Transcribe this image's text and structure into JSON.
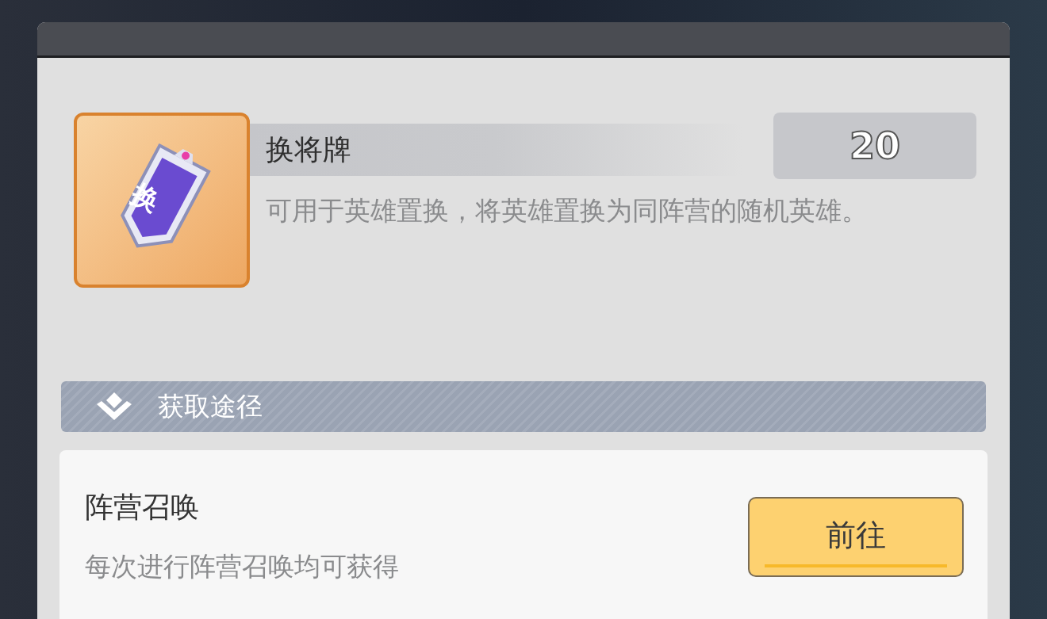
{
  "item": {
    "icon_glyph": "换",
    "name": "换将牌",
    "count": "20",
    "description": "可用于英雄置换，将英雄置换为同阵营的随机英雄。"
  },
  "acquire_section": {
    "title": "获取途径"
  },
  "sources": [
    {
      "title": "阵营召唤",
      "subtitle": "每次进行阵营召唤均可获得",
      "button": "前往"
    }
  ]
}
